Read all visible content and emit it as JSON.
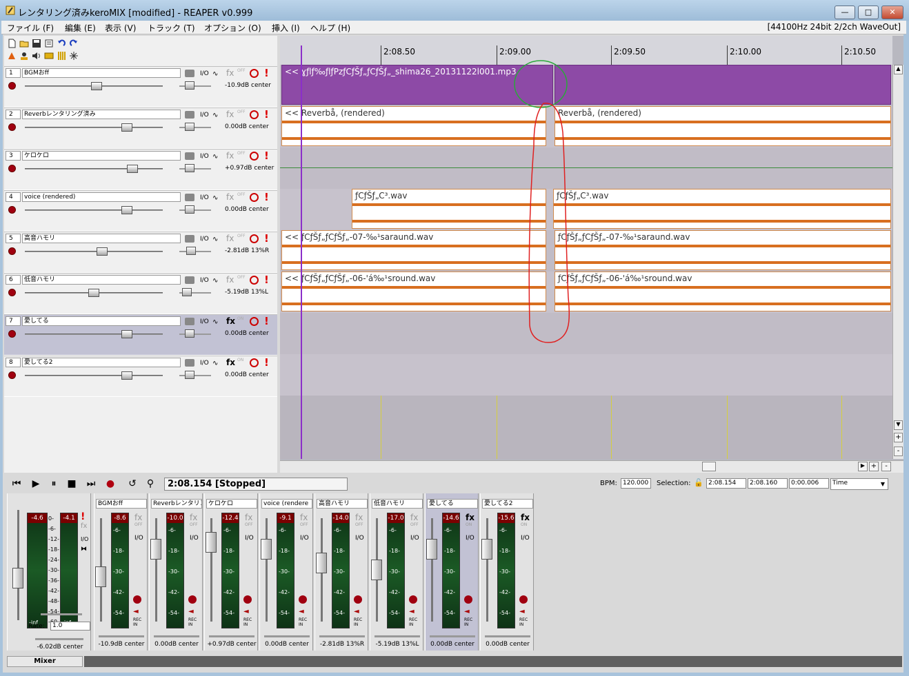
{
  "window": {
    "title": "レンタリング済みkeroMIX [modified] - REAPER v0.999",
    "buttons": {
      "minimize": "—",
      "maximize": "□",
      "close": "✕"
    }
  },
  "menubar": {
    "items": [
      "ファイル (F)",
      "編集 (E)",
      "表示 (V)",
      "トラック (T)",
      "オプション (O)",
      "挿入 (I)",
      "ヘルプ (H)"
    ],
    "audio_format": "[44100Hz 24bit 2/2ch WaveOut]"
  },
  "tracks": [
    {
      "num": "1",
      "name": "BGMおff",
      "volume": "-10.9dB center",
      "fx_state": "OFF",
      "fx_on": false,
      "selected": false
    },
    {
      "num": "2",
      "name": "Reverbレンタリング済み",
      "volume": "0.00dB center",
      "fx_state": "OFF",
      "fx_on": false,
      "selected": false
    },
    {
      "num": "3",
      "name": "ケロケロ",
      "volume": "+0.97dB center",
      "fx_state": "OFF",
      "fx_on": false,
      "selected": false
    },
    {
      "num": "4",
      "name": "voice (rendered)",
      "volume": "0.00dB center",
      "fx_state": "OFF",
      "fx_on": false,
      "selected": false
    },
    {
      "num": "5",
      "name": "高音ハモリ",
      "volume": "-2.81dB 13%R",
      "fx_state": "OFF",
      "fx_on": false,
      "selected": false
    },
    {
      "num": "6",
      "name": "低音ハモリ",
      "volume": "-5.19dB 13%L",
      "fx_state": "OFF",
      "fx_on": false,
      "selected": false
    },
    {
      "num": "7",
      "name": "愛してる",
      "volume": "0.00dB center",
      "fx_state": "ON",
      "fx_on": true,
      "selected": true
    },
    {
      "num": "8",
      "name": "愛してる2",
      "volume": "0.00dB center",
      "fx_state": "ON",
      "fx_on": true,
      "selected": false
    }
  ],
  "track_labels": {
    "io": "I/O",
    "fx": "fx",
    "solo": "!"
  },
  "ruler": {
    "labels": [
      "2:08.50",
      "2:09.00",
      "2:09.50",
      "2:10.00",
      "2:10.50"
    ]
  },
  "items": {
    "t1": "<< ɣƒlƒ‰ƒlƒPzƒCƒŠƒ„ƒCƒŠƒ„_shima26_20131122l001.mp3",
    "t2a": "<< Reverbå, (rendered)",
    "t2b": "Reverbå, (rendered)",
    "t4a": "ƒCƒŠƒ„C³.wav",
    "t4b": "ƒCƒŠƒ„C³.wav",
    "t5a": "<< ƒCƒŠƒ„ƒCƒŠƒ„-07-‰¹saraund.wav",
    "t5b": "ƒCƒŠƒ„ƒCƒŠƒ„-07-‰¹saraund.wav",
    "t6a": "<< ƒCƒŠƒ„ƒCƒŠƒ„-06-'á‰¹sround.wav",
    "t6b": "ƒCƒŠƒ„ƒCƒŠƒ„-06-'á‰¹sround.wav"
  },
  "transport": {
    "time": "2:08.154 [Stopped]",
    "bpm_label": "BPM:",
    "bpm": "120.000",
    "selection_label": "Selection:",
    "sel_start": "2:08.154",
    "sel_end": "2:08.160",
    "sel_len": "0:00.006",
    "time_mode": "Time"
  },
  "mixer": {
    "master": {
      "peak_l": "-4.6",
      "peak_r": "-4.1",
      "rate_label": "Rate:",
      "rate": "1.0",
      "volume": "-6.02dB center",
      "scale": [
        "0-",
        "-6-",
        "-12-",
        "-18-",
        "-24-",
        "-30-",
        "-36-",
        "-42-",
        "-48-",
        "-54-",
        "-60-"
      ],
      "inf_l": "-inf",
      "inf_r": "-inf"
    },
    "strips": [
      {
        "name": "BGMおff",
        "peak": "-8.6",
        "volume": "-10.9dB center",
        "fx": "OFF",
        "fx_on": false
      },
      {
        "name": "Reverbレンタリン",
        "peak": "-10.0",
        "volume": "0.00dB center",
        "fx": "OFF",
        "fx_on": false
      },
      {
        "name": "ケロケロ",
        "peak": "-12.4",
        "volume": "+0.97dB center",
        "fx": "OFF",
        "fx_on": false
      },
      {
        "name": "voice (rendere",
        "peak": "-9.1",
        "volume": "0.00dB center",
        "fx": "OFF",
        "fx_on": false
      },
      {
        "name": "高音ハモリ",
        "peak": "-14.0",
        "volume": "-2.81dB 13%R",
        "fx": "OFF",
        "fx_on": false
      },
      {
        "name": "低音ハモリ",
        "peak": "-17.0",
        "volume": "-5.19dB 13%L",
        "fx": "OFF",
        "fx_on": false
      },
      {
        "name": "愛してる",
        "peak": "-14.6",
        "volume": "0.00dB center",
        "fx": "ON",
        "fx_on": true
      },
      {
        "name": "愛してる2",
        "peak": "-15.6",
        "volume": "0.00dB center",
        "fx": "ON",
        "fx_on": true
      }
    ],
    "scale": [
      "-6-",
      "-18-",
      "-30-",
      "-42-",
      "-54-"
    ],
    "io": "I/O",
    "rec_label": "REC IN",
    "tab": "Mixer"
  },
  "colors": {
    "purple_item": "#8d4aa6",
    "orange_wave": "#d86f20",
    "grid": "#d6cf3c",
    "cursor": "#8b2fc9",
    "annotation_red": "#e02020",
    "annotation_green": "#2aa83a"
  }
}
